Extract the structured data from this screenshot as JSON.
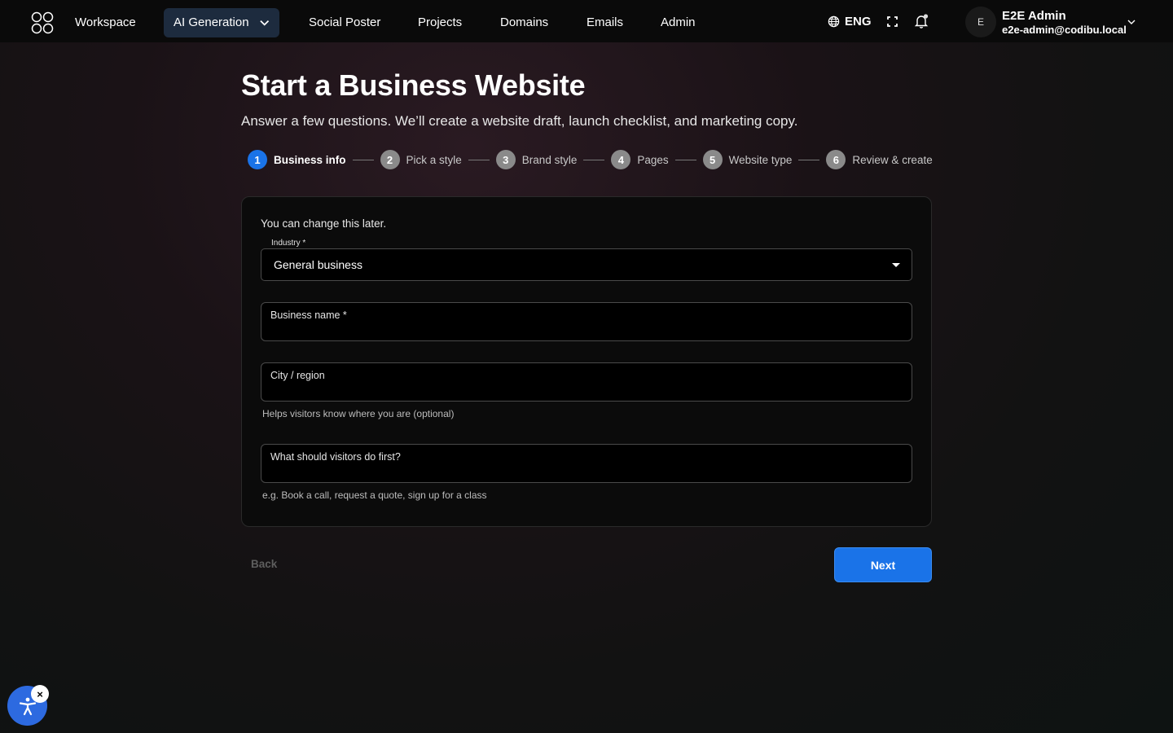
{
  "nav": {
    "items": [
      {
        "label": "Workspace"
      },
      {
        "label": "AI Generation"
      },
      {
        "label": "Social Poster"
      },
      {
        "label": "Projects"
      },
      {
        "label": "Domains"
      },
      {
        "label": "Emails"
      },
      {
        "label": "Admin"
      }
    ],
    "language": "ENG",
    "user": {
      "initial": "E",
      "name": "E2E Admin",
      "email": "e2e-admin@codibu.local"
    }
  },
  "header": {
    "title": "Start a Business Website",
    "subtitle": "Answer a few questions. We’ll create a website draft, launch checklist, and marketing copy."
  },
  "stepper": {
    "current": 1,
    "steps": [
      {
        "num": "1",
        "label": "Business info"
      },
      {
        "num": "2",
        "label": "Pick a style"
      },
      {
        "num": "3",
        "label": "Brand style"
      },
      {
        "num": "4",
        "label": "Pages"
      },
      {
        "num": "5",
        "label": "Website type"
      },
      {
        "num": "6",
        "label": "Review & create"
      }
    ]
  },
  "form": {
    "hint": "You can change this later.",
    "industry": {
      "label": "Industry *",
      "value": "General business"
    },
    "business_name": {
      "label": "Business name *",
      "value": ""
    },
    "city": {
      "label": "City / region",
      "value": "",
      "helper": "Helps visitors know where you are (optional)"
    },
    "first_action": {
      "label": "What should visitors do first?",
      "value": "",
      "helper": "e.g. Book a call, request a quote, sign up for a class"
    }
  },
  "actions": {
    "back": "Back",
    "next": "Next"
  },
  "accessibility": {
    "close": "×"
  },
  "colors": {
    "accent": "#1a73e8",
    "nav_active_bg": "#1d2b3e",
    "card_bg": "#0b0b0b"
  }
}
